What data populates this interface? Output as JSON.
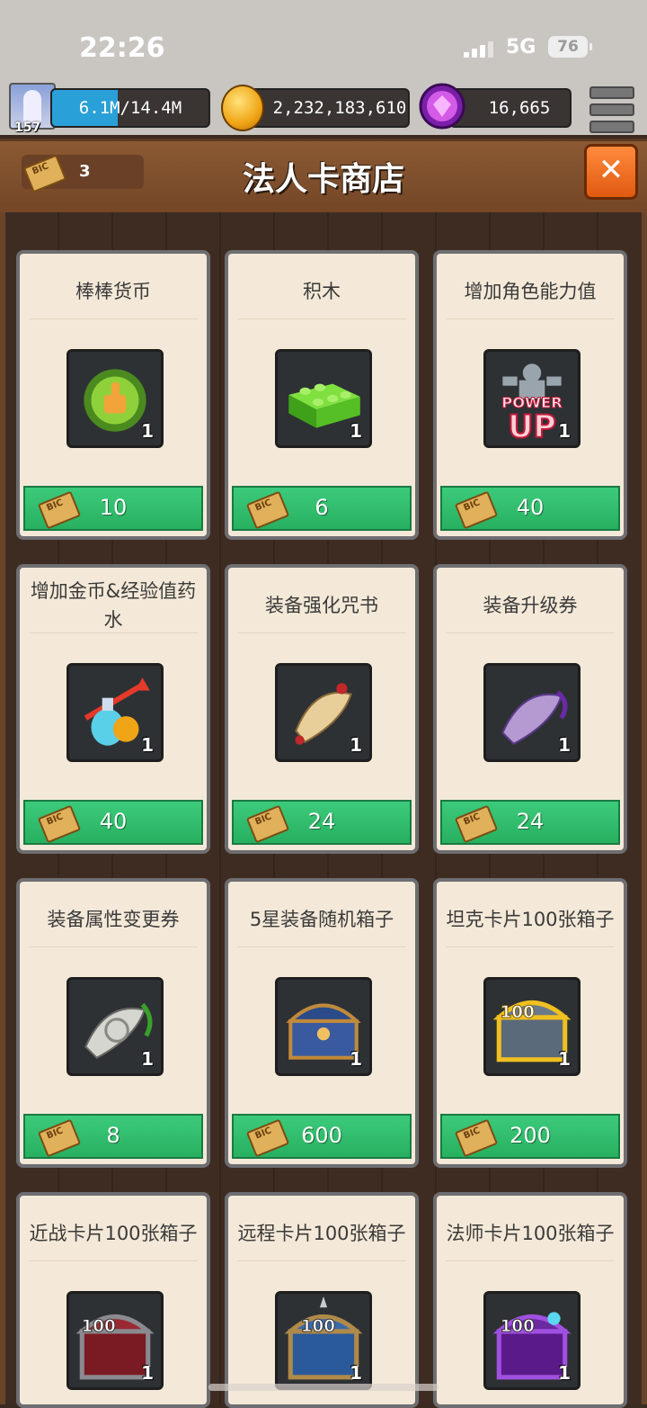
{
  "status": {
    "time": "22:26",
    "network": "5G",
    "battery": "76"
  },
  "player": {
    "level": "157",
    "xp_text": "6.1M/14.4M",
    "xp_progress": 0.42,
    "gold": "2,232,183,610",
    "gems": "16,665"
  },
  "header": {
    "title": "法人卡商店",
    "ticket_count": "3",
    "close_label": "✕"
  },
  "shop": {
    "items": [
      {
        "name": "棒棒货币",
        "qty": "1",
        "price": "10",
        "icon": "thumbs-up-coin-icon"
      },
      {
        "name": "积木",
        "qty": "1",
        "price": "6",
        "icon": "green-brick-icon"
      },
      {
        "name": "增加角色能力值",
        "qty": "1",
        "price": "40",
        "icon": "power-up-icon"
      },
      {
        "name": "增加金币&经验值药水",
        "qty": "1",
        "price": "40",
        "icon": "potion-icon"
      },
      {
        "name": "装备强化咒书",
        "qty": "1",
        "price": "24",
        "icon": "scroll-icon"
      },
      {
        "name": "装备升级券",
        "qty": "1",
        "price": "24",
        "icon": "purple-scroll-icon"
      },
      {
        "name": "装备属性变更券",
        "qty": "1",
        "price": "8",
        "icon": "gray-scroll-icon"
      },
      {
        "name": "5星装备随机箱子",
        "qty": "1",
        "price": "600",
        "icon": "blue-chest-icon"
      },
      {
        "name": "坦克卡片100张箱子",
        "qty": "1",
        "price": "200",
        "icon": "gold-chest-icon"
      },
      {
        "name": "近战卡片100张箱子",
        "qty": "1",
        "price": "",
        "icon": "red-chest-icon"
      },
      {
        "name": "远程卡片100张箱子",
        "qty": "1",
        "price": "",
        "icon": "blue-spiked-chest-icon"
      },
      {
        "name": "法师卡片100张箱子",
        "qty": "1",
        "price": "",
        "icon": "purple-chest-icon"
      }
    ]
  },
  "power_up_text": {
    "top": "POWER",
    "bottom": "UP"
  },
  "chest_label": "100"
}
